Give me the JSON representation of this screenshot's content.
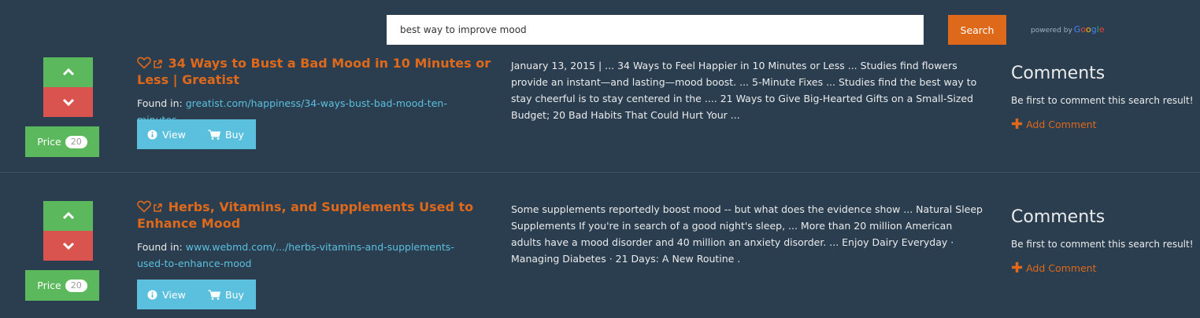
{
  "search": {
    "query": "best way to improve mood",
    "button_label": "Search",
    "powered_by": "powered by",
    "google_letters": [
      "G",
      "o",
      "o",
      "g",
      "l",
      "e"
    ]
  },
  "results": [
    {
      "price_label": "Price",
      "price_value": "20",
      "title": "34 Ways to Bust a Bad Mood in 10 Minutes or Less | Greatist",
      "found_label": "Found in:",
      "found_url": "greatist.com/happiness/34-ways-bust-bad-mood-ten-minutes",
      "view_label": "View",
      "buy_label": "Buy",
      "snippet": "January 13, 2015 | ... 34 Ways to Feel Happier in 10 Minutes or Less ... Studies find flowers provide an instant—and lasting—mood boost. ... 5-Minute Fixes ... Studies find the best way to stay cheerful is to stay centered in the .... 21 Ways to Give Big-Hearted Gifts on a Small-Sized Budget; 20 Bad Habits That Could Hurt Your ...",
      "comments_heading": "Comments",
      "comments_text": "Be first to comment this search result!",
      "add_comment_label": "Add Comment"
    },
    {
      "price_label": "Price",
      "price_value": "20",
      "title": "Herbs, Vitamins, and Supplements Used to Enhance Mood",
      "found_label": "Found in:",
      "found_url": "www.webmd.com/.../herbs-vitamins-and-supplements-used-to-enhance-mood",
      "view_label": "View",
      "buy_label": "Buy",
      "snippet": "Some supplements reportedly boost mood -- but what does the evidence show ... Natural Sleep Supplements If you're in search of a good night's sleep, ... More than 20 million American adults have a mood disorder and 40 million an anxiety disorder. ... Enjoy Dairy Everyday · Managing Diabetes · 21 Days: A New Routine .",
      "comments_heading": "Comments",
      "comments_text": "Be first to comment this search result!",
      "add_comment_label": "Add Comment"
    }
  ],
  "icons": {
    "vote_up": "chevron-up-icon",
    "vote_down": "chevron-down-icon",
    "favorite": "heart-icon",
    "external": "external-link-icon",
    "info": "info-circle-icon",
    "cart": "shopping-cart-icon",
    "plus": "plus-icon"
  },
  "colors": {
    "background": "#2b3e50",
    "accent": "#df691a",
    "success": "#5cb85c",
    "danger": "#d9534f",
    "info": "#5bc0de"
  }
}
